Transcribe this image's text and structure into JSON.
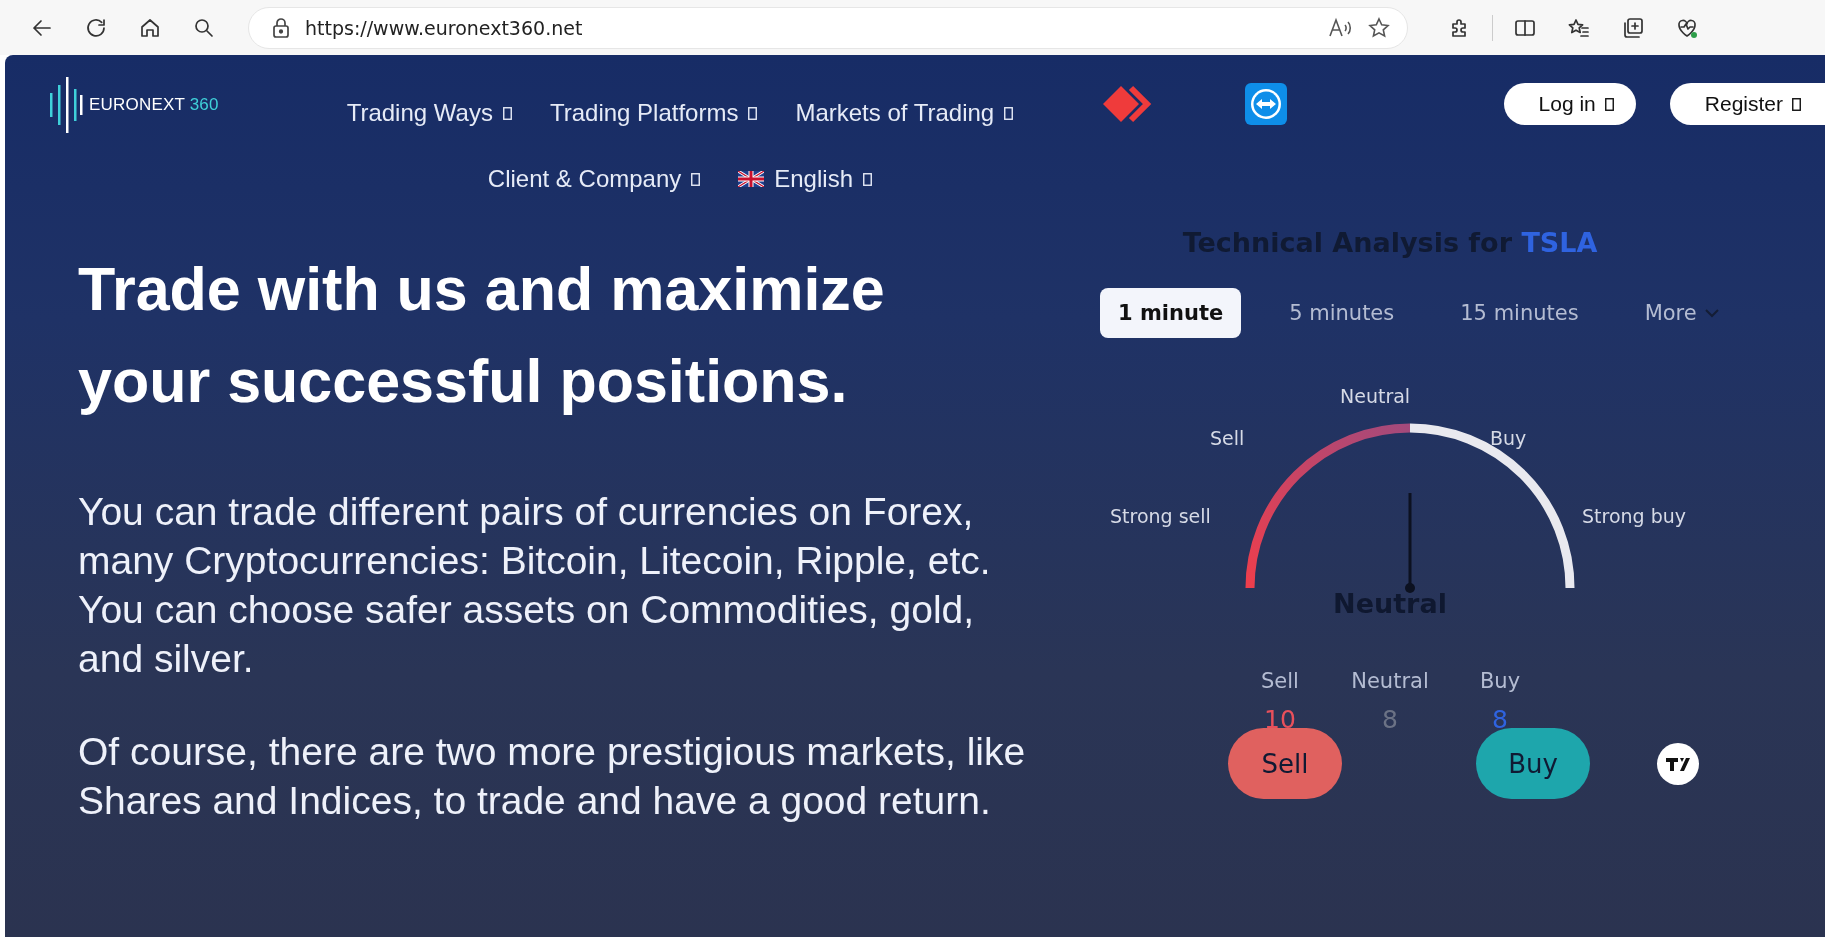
{
  "browser": {
    "url": "https://www.euronext360.net"
  },
  "header": {
    "logo": {
      "name": "EURONEXT",
      "accent": "360"
    },
    "nav_row_1": [
      {
        "label": "Trading Ways"
      },
      {
        "label": "Trading Platforms"
      },
      {
        "label": "Markets of Trading"
      }
    ],
    "nav_row_2": [
      {
        "label": "Client & Company",
        "kind": "menu"
      },
      {
        "label": "English",
        "kind": "language"
      }
    ],
    "buttons": [
      {
        "label": "Log in"
      },
      {
        "label": "Register"
      }
    ]
  },
  "hero": {
    "headline": "Trade with us and maximize your successful positions.",
    "paragraphs": [
      "You can trade different pairs of currencies on Forex, many Cryptocurrencies: Bitcoin, Litecoin, Ripple, etc. You can choose safer assets on Commodities, gold, and silver.",
      "Of course, there are two more prestigious markets, like Shares and Indices, to trade and have a good return."
    ]
  },
  "widget": {
    "title": "Technical Analysis for",
    "symbol": "TSLA",
    "tabs": [
      {
        "label": "1 minute",
        "selected": true
      },
      {
        "label": "5 minutes",
        "selected": false
      },
      {
        "label": "15 minutes",
        "selected": false
      },
      {
        "label": "More",
        "selected": false
      }
    ],
    "gauge": {
      "level": 0.5,
      "labels": [
        "Strong sell",
        "Sell",
        "Neutral",
        "Buy",
        "Strong buy"
      ]
    },
    "summary": "Neutral",
    "counts": [
      {
        "label": "Sell",
        "value": "10",
        "color": "#e8505b"
      },
      {
        "label": "Neutral",
        "value": "8",
        "color": "#6b7285"
      },
      {
        "label": "Buy",
        "value": "8",
        "color": "#2f63e0"
      }
    ],
    "actions": [
      {
        "label": "Sell",
        "kind": "sell"
      },
      {
        "label": "Buy",
        "kind": "buy"
      }
    ]
  }
}
